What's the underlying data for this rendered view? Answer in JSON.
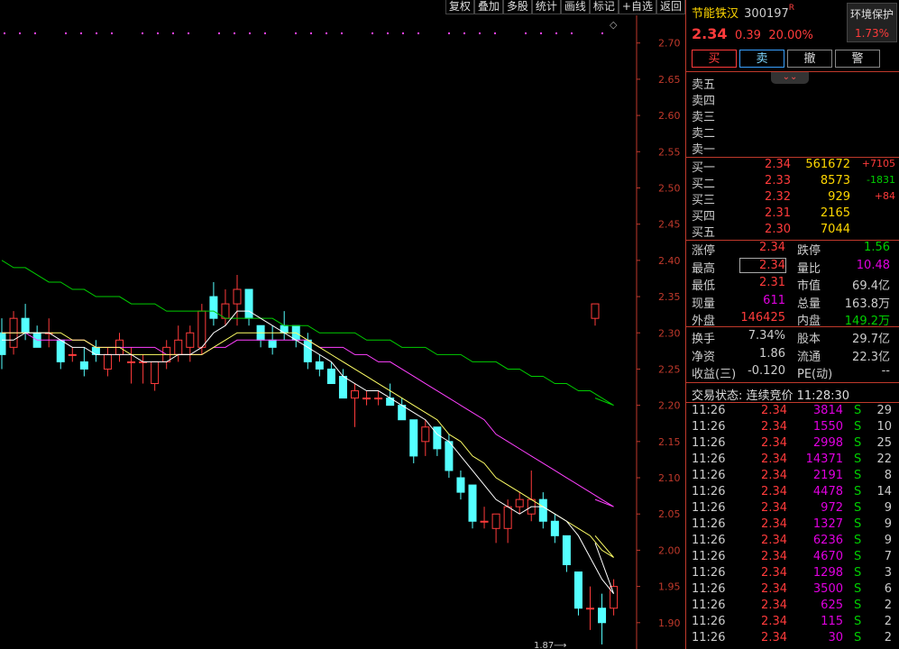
{
  "toolbar": [
    "复权",
    "叠加",
    "多股",
    "统计",
    "画线",
    "标记",
    "+自选",
    "返回"
  ],
  "stock": {
    "name": "节能铁汉",
    "code": "300197",
    "flag": "R",
    "price": "2.34",
    "change": "0.39",
    "change_pct": "20.00%"
  },
  "sector": {
    "name": "环境保护",
    "pct": "1.73%"
  },
  "trade_buttons": {
    "buy": "买",
    "sell": "卖",
    "cancel": "撤",
    "warn": "警"
  },
  "expand_icon": "chevron-double-down",
  "asks": [
    {
      "label": "卖五",
      "price": "",
      "vol": ""
    },
    {
      "label": "卖四",
      "price": "",
      "vol": ""
    },
    {
      "label": "卖三",
      "price": "",
      "vol": ""
    },
    {
      "label": "卖二",
      "price": "",
      "vol": ""
    },
    {
      "label": "卖一",
      "price": "",
      "vol": ""
    }
  ],
  "bids": [
    {
      "label": "买一",
      "price": "2.34",
      "vol": "561672",
      "chg": "+7105",
      "chg_color": "#ff3b3b"
    },
    {
      "label": "买二",
      "price": "2.33",
      "vol": "8573",
      "chg": "-1831",
      "chg_color": "#00d000"
    },
    {
      "label": "买三",
      "price": "2.32",
      "vol": "929",
      "chg": "+84",
      "chg_color": "#ff3b3b"
    },
    {
      "label": "买四",
      "price": "2.31",
      "vol": "2165",
      "chg": ""
    },
    {
      "label": "买五",
      "price": "2.30",
      "vol": "7044",
      "chg": ""
    }
  ],
  "stats1": [
    {
      "k": "涨停",
      "v": "2.34",
      "vc": "#ff3b3b",
      "k2": "跌停",
      "v2": "1.56",
      "v2c": "#00d000"
    },
    {
      "k": "最高",
      "v": "2.34",
      "vc": "#ff3b3b",
      "k2": "量比",
      "v2": "10.48",
      "v2c": "#e000e0"
    },
    {
      "k": "最低",
      "v": "2.31",
      "vc": "#ff3b3b",
      "k2": "市值",
      "v2": "69.4亿",
      "v2c": "#ccc"
    },
    {
      "k": "现量",
      "v": "611",
      "vc": "#e000e0",
      "k2": "总量",
      "v2": "163.8万",
      "v2c": "#ccc"
    },
    {
      "k": "外盘",
      "v": "146425",
      "vc": "#ff3b3b",
      "k2": "内盘",
      "v2": "149.2万",
      "v2c": "#00d000"
    }
  ],
  "stats2": [
    {
      "k": "换手",
      "v": "7.34%",
      "vc": "#ccc",
      "k2": "股本",
      "v2": "29.7亿",
      "v2c": "#ccc"
    },
    {
      "k": "净资",
      "v": "1.86",
      "vc": "#ccc",
      "k2": "流通",
      "v2": "22.3亿",
      "v2c": "#ccc"
    },
    {
      "k": "收益(三)",
      "v": "-0.120",
      "vc": "#ccc",
      "k2": "PE(动)",
      "v2": "--",
      "v2c": "#ccc"
    }
  ],
  "trade_status": "交易状态: 连续竞价 11:28:30",
  "ticks": [
    {
      "t": "11:26",
      "p": "2.34",
      "v": "3814",
      "s": "S",
      "c": "29"
    },
    {
      "t": "11:26",
      "p": "2.34",
      "v": "1550",
      "s": "S",
      "c": "10"
    },
    {
      "t": "11:26",
      "p": "2.34",
      "v": "2998",
      "s": "S",
      "c": "25"
    },
    {
      "t": "11:26",
      "p": "2.34",
      "v": "14371",
      "s": "S",
      "c": "22"
    },
    {
      "t": "11:26",
      "p": "2.34",
      "v": "2191",
      "s": "S",
      "c": "8"
    },
    {
      "t": "11:26",
      "p": "2.34",
      "v": "4478",
      "s": "S",
      "c": "14"
    },
    {
      "t": "11:26",
      "p": "2.34",
      "v": "972",
      "s": "S",
      "c": "9"
    },
    {
      "t": "11:26",
      "p": "2.34",
      "v": "1327",
      "s": "S",
      "c": "9"
    },
    {
      "t": "11:26",
      "p": "2.34",
      "v": "6236",
      "s": "S",
      "c": "9"
    },
    {
      "t": "11:26",
      "p": "2.34",
      "v": "4670",
      "s": "S",
      "c": "7"
    },
    {
      "t": "11:26",
      "p": "2.34",
      "v": "1298",
      "s": "S",
      "c": "3"
    },
    {
      "t": "11:26",
      "p": "2.34",
      "v": "3500",
      "s": "S",
      "c": "6"
    },
    {
      "t": "11:26",
      "p": "2.34",
      "v": "625",
      "s": "S",
      "c": "2"
    },
    {
      "t": "11:26",
      "p": "2.34",
      "v": "115",
      "s": "S",
      "c": "2"
    },
    {
      "t": "11:26",
      "p": "2.34",
      "v": "30",
      "s": "S",
      "c": "2"
    }
  ],
  "chart_data": {
    "type": "candlestick",
    "y_ticks": [
      "2.70",
      "2.65",
      "2.60",
      "2.55",
      "2.50",
      "2.45",
      "2.40",
      "2.35",
      "2.30",
      "2.25",
      "2.20",
      "2.15",
      "2.10",
      "2.05",
      "2.00",
      "1.95",
      "1.90"
    ],
    "ylim": [
      1.87,
      2.72
    ],
    "min_label": "1.87",
    "candles": [
      [
        2.3,
        2.32,
        2.25,
        2.27
      ],
      [
        2.28,
        2.33,
        2.27,
        2.32
      ],
      [
        2.32,
        2.34,
        2.29,
        2.3
      ],
      [
        2.3,
        2.31,
        2.28,
        2.28
      ],
      [
        2.3,
        2.32,
        2.28,
        2.3
      ],
      [
        2.29,
        2.29,
        2.25,
        2.26
      ],
      [
        2.27,
        2.28,
        2.26,
        2.27
      ],
      [
        2.26,
        2.28,
        2.24,
        2.25
      ],
      [
        2.28,
        2.29,
        2.26,
        2.27
      ],
      [
        2.25,
        2.28,
        2.24,
        2.27
      ],
      [
        2.27,
        2.3,
        2.26,
        2.29
      ],
      [
        2.26,
        2.28,
        2.23,
        2.26
      ],
      [
        2.26,
        2.27,
        2.23,
        2.26
      ],
      [
        2.23,
        2.26,
        2.22,
        2.26
      ],
      [
        2.26,
        2.29,
        2.25,
        2.28
      ],
      [
        2.27,
        2.31,
        2.26,
        2.29
      ],
      [
        2.28,
        2.31,
        2.26,
        2.3
      ],
      [
        2.28,
        2.34,
        2.27,
        2.33
      ],
      [
        2.35,
        2.37,
        2.31,
        2.32
      ],
      [
        2.32,
        2.36,
        2.31,
        2.34
      ],
      [
        2.34,
        2.38,
        2.31,
        2.36
      ],
      [
        2.36,
        2.36,
        2.31,
        2.32
      ],
      [
        2.31,
        2.31,
        2.28,
        2.29
      ],
      [
        2.29,
        2.31,
        2.27,
        2.28
      ],
      [
        2.31,
        2.33,
        2.29,
        2.3
      ],
      [
        2.31,
        2.31,
        2.28,
        2.29
      ],
      [
        2.29,
        2.3,
        2.25,
        2.26
      ],
      [
        2.26,
        2.27,
        2.24,
        2.25
      ],
      [
        2.25,
        2.26,
        2.23,
        2.23
      ],
      [
        2.24,
        2.25,
        2.21,
        2.21
      ],
      [
        2.21,
        2.23,
        2.17,
        2.22
      ],
      [
        2.21,
        2.22,
        2.2,
        2.21
      ],
      [
        2.21,
        2.22,
        2.2,
        2.21
      ],
      [
        2.21,
        2.23,
        2.2,
        2.2
      ],
      [
        2.2,
        2.21,
        2.18,
        2.18
      ],
      [
        2.18,
        2.18,
        2.12,
        2.13
      ],
      [
        2.15,
        2.18,
        2.13,
        2.17
      ],
      [
        2.17,
        2.17,
        2.13,
        2.14
      ],
      [
        2.15,
        2.16,
        2.1,
        2.11
      ],
      [
        2.1,
        2.11,
        2.07,
        2.08
      ],
      [
        2.09,
        2.09,
        2.03,
        2.04
      ],
      [
        2.04,
        2.06,
        2.03,
        2.04
      ],
      [
        2.03,
        2.05,
        2.01,
        2.05
      ],
      [
        2.03,
        2.07,
        2.01,
        2.06
      ],
      [
        2.06,
        2.08,
        2.05,
        2.07
      ],
      [
        2.05,
        2.11,
        2.04,
        2.07
      ],
      [
        2.07,
        2.08,
        2.03,
        2.04
      ],
      [
        2.04,
        2.05,
        2.01,
        2.02
      ],
      [
        2.02,
        2.02,
        1.97,
        1.98
      ],
      [
        1.97,
        1.97,
        1.91,
        1.92
      ],
      [
        1.92,
        1.95,
        1.89,
        1.92
      ],
      [
        1.92,
        1.94,
        1.87,
        1.9
      ],
      [
        1.92,
        1.96,
        1.91,
        1.95
      ],
      [
        2.32,
        2.34,
        2.31,
        2.34
      ]
    ],
    "ma5": [
      2.29,
      2.29,
      2.3,
      2.3,
      2.3,
      2.29,
      2.28,
      2.28,
      2.27,
      2.27,
      2.27,
      2.27,
      2.26,
      2.26,
      2.26,
      2.27,
      2.27,
      2.28,
      2.3,
      2.31,
      2.33,
      2.33,
      2.32,
      2.31,
      2.3,
      2.29,
      2.28,
      2.27,
      2.26,
      2.24,
      2.23,
      2.22,
      2.22,
      2.21,
      2.2,
      2.19,
      2.18,
      2.16,
      2.15,
      2.13,
      2.11,
      2.09,
      2.07,
      2.06,
      2.05,
      2.06,
      2.06,
      2.05,
      2.04,
      2.02,
      1.99,
      1.96,
      1.94,
      2.01
    ],
    "ma10": [
      2.3,
      2.3,
      2.3,
      2.3,
      2.3,
      2.3,
      2.29,
      2.29,
      2.28,
      2.28,
      2.28,
      2.27,
      2.27,
      2.27,
      2.27,
      2.27,
      2.27,
      2.27,
      2.28,
      2.29,
      2.3,
      2.3,
      2.3,
      2.3,
      2.3,
      2.3,
      2.29,
      2.28,
      2.27,
      2.26,
      2.25,
      2.24,
      2.23,
      2.22,
      2.21,
      2.2,
      2.19,
      2.18,
      2.16,
      2.15,
      2.13,
      2.12,
      2.1,
      2.09,
      2.08,
      2.07,
      2.06,
      2.05,
      2.04,
      2.03,
      2.02,
      2.0,
      1.99,
      2.02
    ],
    "ma20": [
      2.3,
      2.3,
      2.3,
      2.29,
      2.29,
      2.29,
      2.29,
      2.29,
      2.28,
      2.28,
      2.28,
      2.28,
      2.28,
      2.28,
      2.27,
      2.27,
      2.27,
      2.27,
      2.28,
      2.28,
      2.29,
      2.29,
      2.29,
      2.29,
      2.29,
      2.29,
      2.29,
      2.28,
      2.28,
      2.28,
      2.27,
      2.27,
      2.26,
      2.26,
      2.25,
      2.24,
      2.23,
      2.22,
      2.21,
      2.2,
      2.19,
      2.18,
      2.16,
      2.15,
      2.14,
      2.13,
      2.12,
      2.11,
      2.1,
      2.09,
      2.08,
      2.07,
      2.06,
      2.07
    ],
    "ma60": [
      2.4,
      2.39,
      2.39,
      2.38,
      2.37,
      2.37,
      2.36,
      2.36,
      2.35,
      2.35,
      2.35,
      2.34,
      2.34,
      2.34,
      2.33,
      2.33,
      2.33,
      2.33,
      2.33,
      2.32,
      2.32,
      2.32,
      2.32,
      2.32,
      2.31,
      2.31,
      2.31,
      2.3,
      2.3,
      2.3,
      2.3,
      2.29,
      2.29,
      2.29,
      2.28,
      2.28,
      2.28,
      2.27,
      2.27,
      2.27,
      2.26,
      2.26,
      2.26,
      2.25,
      2.25,
      2.24,
      2.24,
      2.23,
      2.23,
      2.22,
      2.22,
      2.21,
      2.2,
      2.21
    ],
    "ma_colors": {
      "ma5": "#ffffff",
      "ma10": "#ffff66",
      "ma20": "#ff40ff",
      "ma60": "#00cc00"
    },
    "up_color": "#ff3b3b",
    "down_color": "#54ffff"
  }
}
